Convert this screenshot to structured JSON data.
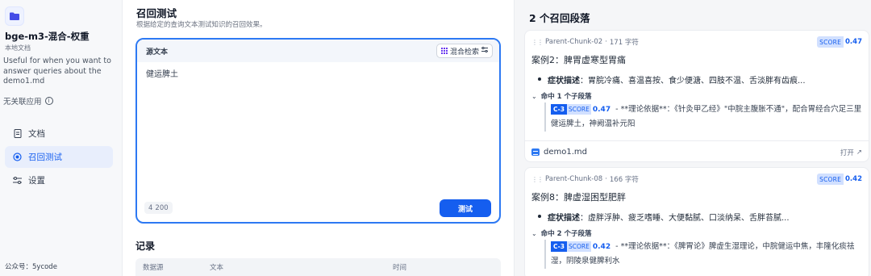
{
  "sidebar": {
    "dataset_name": "bge-m3-混合-权重",
    "dataset_type": "本地文档",
    "description": "Useful for when you want to answer queries about the demo1.md",
    "no_app": "无关联应用",
    "nav": [
      {
        "label": "文档",
        "icon": "document-icon"
      },
      {
        "label": "召回测试",
        "icon": "target-icon",
        "active": true
      },
      {
        "label": "设置",
        "icon": "settings-icon"
      }
    ],
    "footer": "公众号：5ycode"
  },
  "main": {
    "title": "召回测试",
    "subtitle": "根据给定的查询文本测试知识的召回效果。",
    "source_label": "源文本",
    "method_label": "混合检索",
    "query_text": "健运脾土",
    "char_count": "4",
    "char_limit": "200",
    "test_button": "测试",
    "records_title": "记录",
    "records_columns": [
      "数据源",
      "文本",
      "时间"
    ]
  },
  "results": {
    "title": "2 个召回段落",
    "score_label": "SCORE",
    "open_label": "打开",
    "cards": [
      {
        "chunk_id": "Parent-Chunk-02",
        "chars": "171 字符",
        "score": "0.47",
        "heading": "案例2：脾胃虚寒型胃痛",
        "bullet_label": "症状描述",
        "bullet_text": "：胃脘冷痛、喜温喜按、食少便溏、四肢不温、舌淡胖有齿痕...",
        "hits": "命中 1 个子段落",
        "child_tag": "C-3",
        "child_score": "0.47",
        "child_text": "- **理论依据**：《针灸甲乙经》\"中脘主腹胀不通\"，配合胃经合穴足三里健运脾土，神阙温补元阳",
        "file": "demo1.md"
      },
      {
        "chunk_id": "Parent-Chunk-08",
        "chars": "166 字符",
        "score": "0.42",
        "heading": "案例8：脾虚湿困型肥胖",
        "bullet_label": "症状描述",
        "bullet_text": "：虚胖浮肿、疲乏嗜睡、大便黏腻、口淡纳呆、舌胖苔腻...",
        "hits": "命中 2 个子段落",
        "child_tag": "C-3",
        "child_score": "0.42",
        "child_text": "- **理论依据**：《脾胃论》脾虚生湿理论，中脘健运中焦，丰隆化痰祛湿，阴陵泉健脾利水"
      }
    ]
  }
}
